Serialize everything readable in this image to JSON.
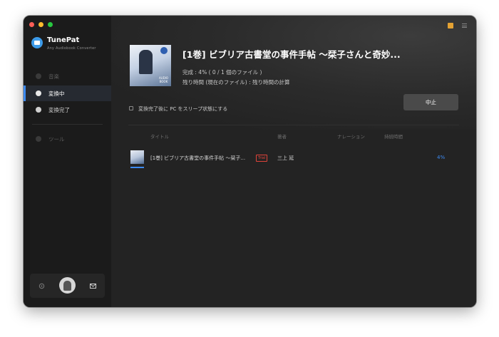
{
  "app": {
    "name": "TunePat",
    "subtitle": "Any Audiobook Converter"
  },
  "window_controls": {
    "close_color": "#ff5f57",
    "minimize_color": "#febc2e",
    "zoom_color": "#28c840"
  },
  "sidebar": {
    "items": [
      {
        "label": "音楽",
        "icon": "music-icon",
        "active": false,
        "dim": true
      },
      {
        "label": "変換中",
        "icon": "converting-icon",
        "active": true,
        "dim": false
      },
      {
        "label": "変換完了",
        "icon": "history-icon",
        "active": false,
        "dim": false
      },
      {
        "label": "ツール",
        "icon": "tools-icon",
        "active": false,
        "dim": true
      }
    ],
    "footer": {
      "settings_icon": "gear-icon",
      "avatar_icon": "avatar",
      "mail_icon": "mail-icon"
    }
  },
  "header": {
    "cart_icon": "cart-icon",
    "menu_icon": "menu-icon"
  },
  "current": {
    "title": "[1巻] ビブリア古書堂の事件手帖 ～栞子さんと奇妙...",
    "progress": "完成 : 4% ( 0 / 1 個のファイル )",
    "remaining": "残り時間 (現在のファイル) : 残り時間の計算",
    "cover_label_1": "AUDIO",
    "cover_label_2": "BOOK"
  },
  "options": {
    "sleep_label": "変換完了後に PC をスリープ状態にする",
    "sleep_checked": false
  },
  "actions": {
    "stop_label": "中止"
  },
  "table": {
    "columns": [
      "タイトル",
      "著者",
      "ナレーション",
      "持続時間"
    ],
    "rows": [
      {
        "title": "[1巻] ビブリア古書堂の事件手帖 ～栞子...",
        "badge": "Trial",
        "author": "三上 延",
        "narration": "",
        "duration": "",
        "percent": "4%",
        "progress": 0.04
      }
    ]
  },
  "colors": {
    "accent": "#3d8bf2",
    "trial": "#e0433a",
    "cart": "#e4a233"
  }
}
